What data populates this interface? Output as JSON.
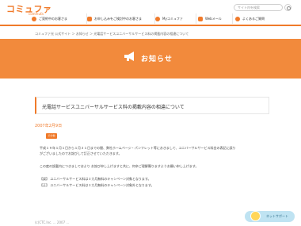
{
  "header": {
    "logo": "コミュファ",
    "logo_sub": "commufa",
    "search_placeholder": "サイト内を検索"
  },
  "nav": {
    "items": [
      {
        "label": "ご契約中のお客さま",
        "icon": "user-icon"
      },
      {
        "label": "お申し込みをご検討中のお客さま",
        "icon": "document-icon"
      },
      {
        "label": "Myコミュファ",
        "icon": "heart-icon"
      },
      {
        "label": "Webメール",
        "icon": "mail-icon"
      },
      {
        "label": "よくあるご質問",
        "icon": "question-icon"
      }
    ]
  },
  "breadcrumb": "コミュファ光 公式サイト ＞ お知らせ ＞ 光電話サービスユニバーサルサービス料の掲載内容の相違について",
  "banner": {
    "title": "お知らせ",
    "icon": "megaphone-icon"
  },
  "article": {
    "title": "光電話サービスユニバーサルサービス料の掲載内容の相違について",
    "date": "2007年2月9日",
    "tag": "その他",
    "paragraphs": [
      "平成１９年１月１日から１月３１日までの間、弊社ホームページ・パンフレット等におきまして、ユニバーサルサービス料金の表記に誤り",
      "がございましたのでお詫びして訂正させていただきます。",
      "この度の誤載内につきましてはより お詫び申し上げますと共に、何卒ご理解賜りますようお願い申し上げます。",
      "【誤】 ユニバーサルサービス料は３カ月無料のキャンペーン対象となります。",
      "【正】 ユニバーサルサービス料は３カ月無料のキャンペーン対象外となります。"
    ]
  },
  "support": {
    "label": "ネットサポート"
  },
  "footer": {
    "text": "(c)CTC.Inc. ... 2007 ..."
  }
}
